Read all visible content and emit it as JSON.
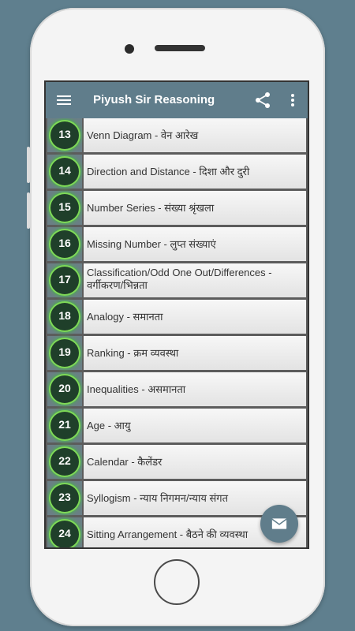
{
  "appbar": {
    "title": "Piyush Sir Reasoning",
    "menu_icon": "hamburger-menu-icon",
    "share_icon": "share-icon",
    "more_icon": "more-vert-icon"
  },
  "colors": {
    "appbar": "#607d8b",
    "background": "#5f7f8e",
    "badge_ring": "#7ed957"
  },
  "topics": [
    {
      "number": "13",
      "label": "Venn Diagram - वेन आरेख"
    },
    {
      "number": "14",
      "label": "Direction and Distance - दिशा और दुरी"
    },
    {
      "number": "15",
      "label": "Number Series - संख्या श्रृंखला"
    },
    {
      "number": "16",
      "label": "Missing Number - लुप्त संख्याएं"
    },
    {
      "number": "17",
      "label": "Classification/Odd One Out/Differences - वर्गीकरण/भिन्नता"
    },
    {
      "number": "18",
      "label": "Analogy - समानता"
    },
    {
      "number": "19",
      "label": "Ranking - क्रम व्यवस्था"
    },
    {
      "number": "20",
      "label": "Inequalities - असमानता"
    },
    {
      "number": "21",
      "label": "Age - आयु"
    },
    {
      "number": "22",
      "label": "Calendar - कैलेंडर"
    },
    {
      "number": "23",
      "label": "Syllogism - न्याय निगमन/न्याय संगत"
    },
    {
      "number": "24",
      "label": "Sitting Arrangement - बैठने की व्यवस्था"
    }
  ],
  "fab": {
    "icon": "email-icon"
  }
}
